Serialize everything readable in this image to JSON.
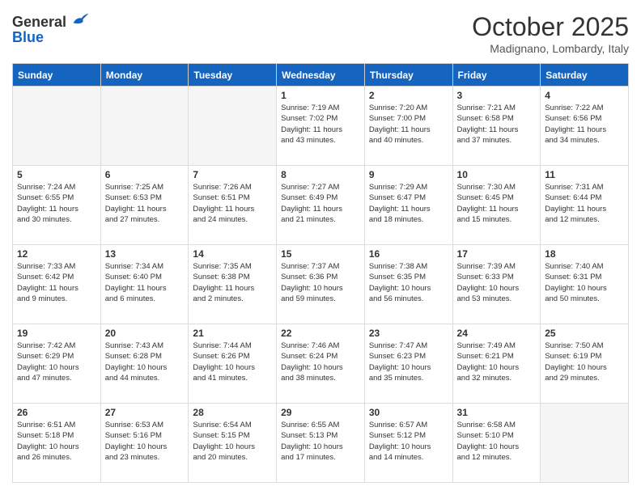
{
  "header": {
    "logo_general": "General",
    "logo_blue": "Blue",
    "month": "October 2025",
    "location": "Madignano, Lombardy, Italy"
  },
  "days_of_week": [
    "Sunday",
    "Monday",
    "Tuesday",
    "Wednesday",
    "Thursday",
    "Friday",
    "Saturday"
  ],
  "weeks": [
    [
      {
        "day": "",
        "info": ""
      },
      {
        "day": "",
        "info": ""
      },
      {
        "day": "",
        "info": ""
      },
      {
        "day": "1",
        "info": "Sunrise: 7:19 AM\nSunset: 7:02 PM\nDaylight: 11 hours\nand 43 minutes."
      },
      {
        "day": "2",
        "info": "Sunrise: 7:20 AM\nSunset: 7:00 PM\nDaylight: 11 hours\nand 40 minutes."
      },
      {
        "day": "3",
        "info": "Sunrise: 7:21 AM\nSunset: 6:58 PM\nDaylight: 11 hours\nand 37 minutes."
      },
      {
        "day": "4",
        "info": "Sunrise: 7:22 AM\nSunset: 6:56 PM\nDaylight: 11 hours\nand 34 minutes."
      }
    ],
    [
      {
        "day": "5",
        "info": "Sunrise: 7:24 AM\nSunset: 6:55 PM\nDaylight: 11 hours\nand 30 minutes."
      },
      {
        "day": "6",
        "info": "Sunrise: 7:25 AM\nSunset: 6:53 PM\nDaylight: 11 hours\nand 27 minutes."
      },
      {
        "day": "7",
        "info": "Sunrise: 7:26 AM\nSunset: 6:51 PM\nDaylight: 11 hours\nand 24 minutes."
      },
      {
        "day": "8",
        "info": "Sunrise: 7:27 AM\nSunset: 6:49 PM\nDaylight: 11 hours\nand 21 minutes."
      },
      {
        "day": "9",
        "info": "Sunrise: 7:29 AM\nSunset: 6:47 PM\nDaylight: 11 hours\nand 18 minutes."
      },
      {
        "day": "10",
        "info": "Sunrise: 7:30 AM\nSunset: 6:45 PM\nDaylight: 11 hours\nand 15 minutes."
      },
      {
        "day": "11",
        "info": "Sunrise: 7:31 AM\nSunset: 6:44 PM\nDaylight: 11 hours\nand 12 minutes."
      }
    ],
    [
      {
        "day": "12",
        "info": "Sunrise: 7:33 AM\nSunset: 6:42 PM\nDaylight: 11 hours\nand 9 minutes."
      },
      {
        "day": "13",
        "info": "Sunrise: 7:34 AM\nSunset: 6:40 PM\nDaylight: 11 hours\nand 6 minutes."
      },
      {
        "day": "14",
        "info": "Sunrise: 7:35 AM\nSunset: 6:38 PM\nDaylight: 11 hours\nand 2 minutes."
      },
      {
        "day": "15",
        "info": "Sunrise: 7:37 AM\nSunset: 6:36 PM\nDaylight: 10 hours\nand 59 minutes."
      },
      {
        "day": "16",
        "info": "Sunrise: 7:38 AM\nSunset: 6:35 PM\nDaylight: 10 hours\nand 56 minutes."
      },
      {
        "day": "17",
        "info": "Sunrise: 7:39 AM\nSunset: 6:33 PM\nDaylight: 10 hours\nand 53 minutes."
      },
      {
        "day": "18",
        "info": "Sunrise: 7:40 AM\nSunset: 6:31 PM\nDaylight: 10 hours\nand 50 minutes."
      }
    ],
    [
      {
        "day": "19",
        "info": "Sunrise: 7:42 AM\nSunset: 6:29 PM\nDaylight: 10 hours\nand 47 minutes."
      },
      {
        "day": "20",
        "info": "Sunrise: 7:43 AM\nSunset: 6:28 PM\nDaylight: 10 hours\nand 44 minutes."
      },
      {
        "day": "21",
        "info": "Sunrise: 7:44 AM\nSunset: 6:26 PM\nDaylight: 10 hours\nand 41 minutes."
      },
      {
        "day": "22",
        "info": "Sunrise: 7:46 AM\nSunset: 6:24 PM\nDaylight: 10 hours\nand 38 minutes."
      },
      {
        "day": "23",
        "info": "Sunrise: 7:47 AM\nSunset: 6:23 PM\nDaylight: 10 hours\nand 35 minutes."
      },
      {
        "day": "24",
        "info": "Sunrise: 7:49 AM\nSunset: 6:21 PM\nDaylight: 10 hours\nand 32 minutes."
      },
      {
        "day": "25",
        "info": "Sunrise: 7:50 AM\nSunset: 6:19 PM\nDaylight: 10 hours\nand 29 minutes."
      }
    ],
    [
      {
        "day": "26",
        "info": "Sunrise: 6:51 AM\nSunset: 5:18 PM\nDaylight: 10 hours\nand 26 minutes."
      },
      {
        "day": "27",
        "info": "Sunrise: 6:53 AM\nSunset: 5:16 PM\nDaylight: 10 hours\nand 23 minutes."
      },
      {
        "day": "28",
        "info": "Sunrise: 6:54 AM\nSunset: 5:15 PM\nDaylight: 10 hours\nand 20 minutes."
      },
      {
        "day": "29",
        "info": "Sunrise: 6:55 AM\nSunset: 5:13 PM\nDaylight: 10 hours\nand 17 minutes."
      },
      {
        "day": "30",
        "info": "Sunrise: 6:57 AM\nSunset: 5:12 PM\nDaylight: 10 hours\nand 14 minutes."
      },
      {
        "day": "31",
        "info": "Sunrise: 6:58 AM\nSunset: 5:10 PM\nDaylight: 10 hours\nand 12 minutes."
      },
      {
        "day": "",
        "info": ""
      }
    ]
  ]
}
